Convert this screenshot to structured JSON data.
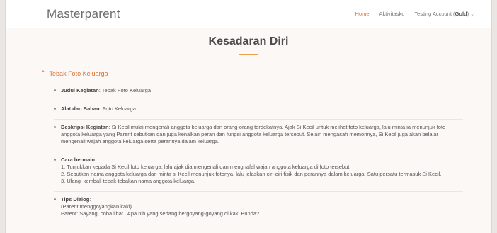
{
  "header": {
    "brand": "Masterparent",
    "nav": {
      "home": "Home",
      "activity": "Aktivitasku",
      "account_prefix": "Testing Account (",
      "account_bold": "Gold",
      "account_suffix": ")"
    }
  },
  "page": {
    "title": "Kesadaran Diri"
  },
  "section": {
    "title": "Tebak Foto Keluarga"
  },
  "items": [
    {
      "label": "Judul Kegiatan",
      "text": ": Tebak Foto Keluarga",
      "lines": []
    },
    {
      "label": "Alat dan Bahan",
      "text": ": Foto Keluarga",
      "lines": []
    },
    {
      "label": "Deskripsi Kegiatan",
      "text": ": Si Kecil mulai mengenali anggota keluarga dan orang-orang terdekatnya. Ajak Si Kecil untuk melihat foto keluarga, lalu minta ia menunjuk foto anggota keluarga yang Parent sebutkan dan juga kenalkan peran dan fungsi anggota keluarga tersebut. Selain mengasah memorinya, Si Kecil juga akan belajar mengenali wajah anggota keluarga serta perannya dalam keluarga.",
      "lines": []
    },
    {
      "label": "Cara bermain",
      "text": ":",
      "lines": [
        "1. Tunjukkan kepada Si Kecil foto keluarga, lalu ajak dia mengenali dan menghafal wajah anggota keluarga di foto tersebut.",
        "2. Sebutkan nama anggota keluarga dan minta si Kecil menunjuk fotonya, lalu jelaskan ciri-ciri fisik dan perannya dalam keluarga. Satu persatu termasuk Si Kecil.",
        "3. Ulangi kembali tebak-tebakan nama anggota keluarga."
      ]
    },
    {
      "label": "Tips Dialog",
      "text": ":",
      "lines": [
        "(Parent menggoyangkan kaki)",
        "Parent: Sayang, coba lihat.. Apa nih yang sedang bergoyang-goyang di kaki Bunda?"
      ]
    }
  ]
}
